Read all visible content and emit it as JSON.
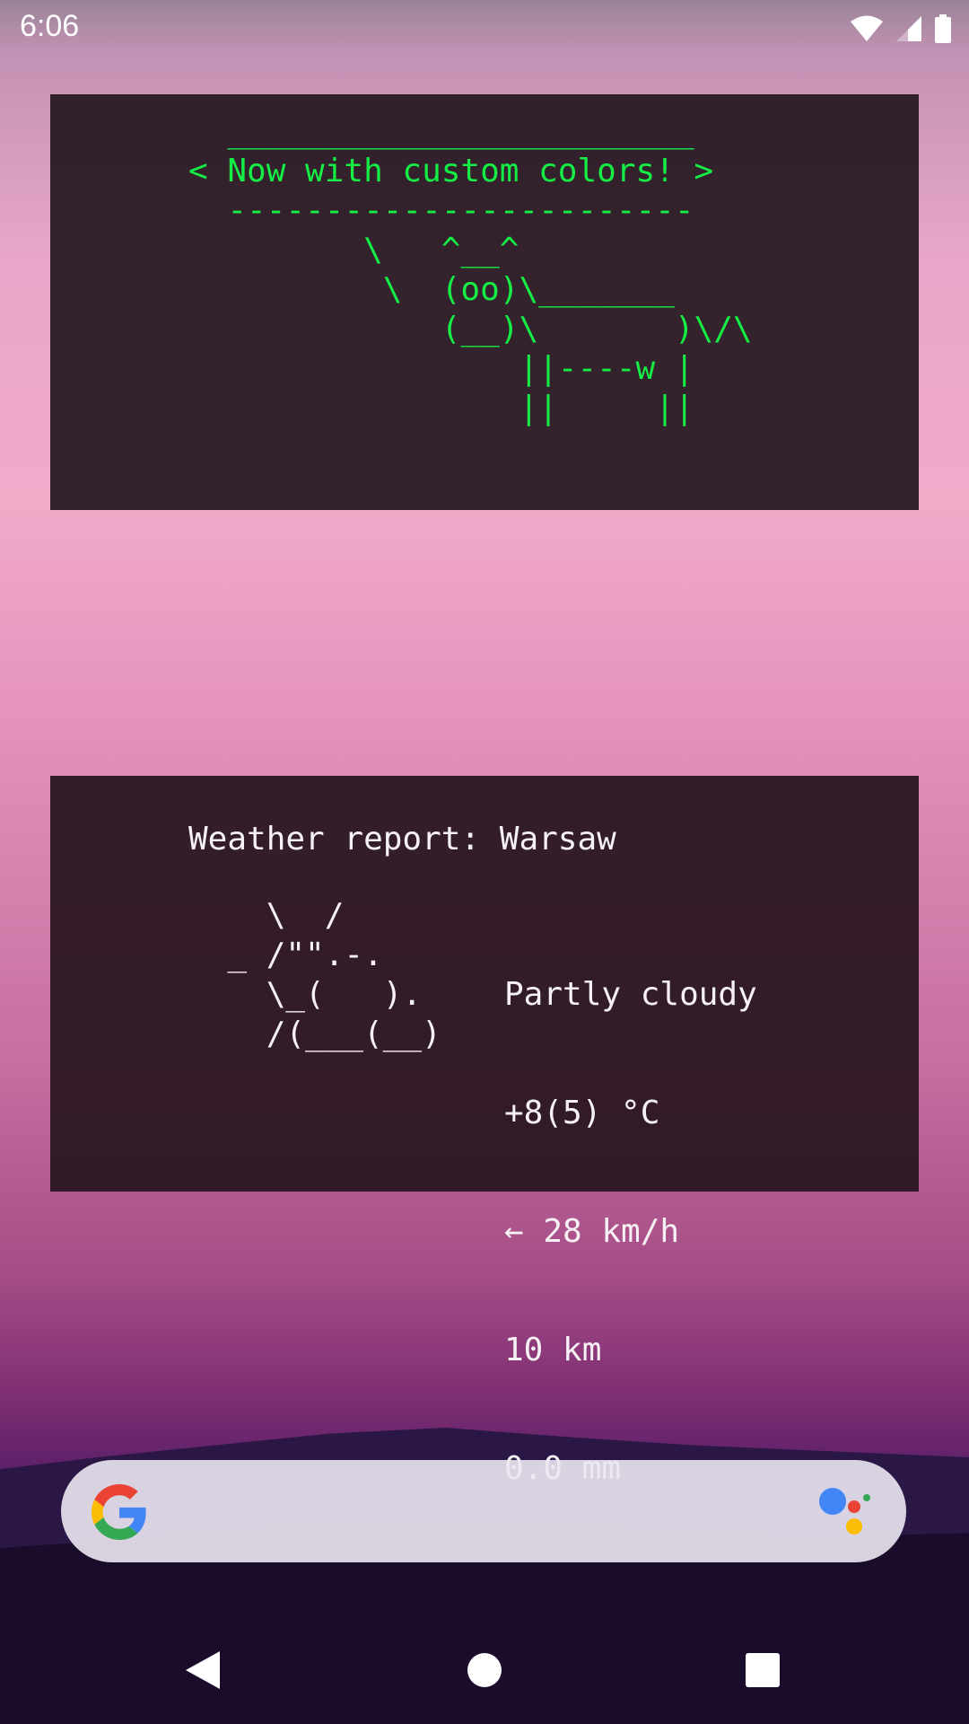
{
  "status_bar": {
    "time": "6:06",
    "icons": [
      "wifi-icon",
      "cell-signal-icon",
      "battery-icon"
    ]
  },
  "cowsay_widget": {
    "text_color": "#15ee44",
    "lines": [
      "  ________________________",
      "< Now with custom colors! >",
      "  ------------------------",
      "         \\   ^__^",
      "          \\  (oo)\\_______",
      "             (__)\\       )\\/\\",
      "                 ||----w |",
      "                 ||     ||"
    ]
  },
  "weather_widget": {
    "title": "Weather report: Warsaw",
    "art_lines": [
      "    \\  /",
      "  _ /\"\".-.",
      "    \\_(   ).",
      "    /(___(__)"
    ],
    "condition": "Partly cloudy",
    "temperature": "+8(5) °C",
    "wind": "← 28 km/h",
    "visibility": "10 km",
    "precipitation": "0.0 mm"
  },
  "search_bar": {
    "logo": "google-g-icon",
    "assistant": "google-assistant-icon"
  },
  "nav_bar": {
    "buttons": [
      "back-icon",
      "home-icon",
      "recents-icon"
    ]
  }
}
